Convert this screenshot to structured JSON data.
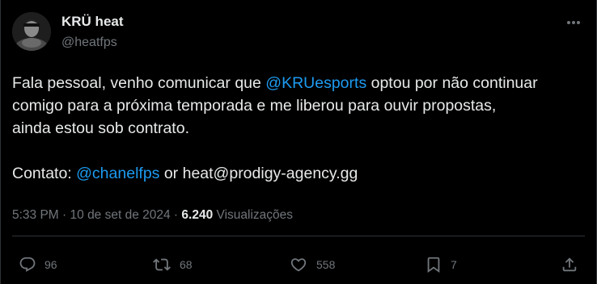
{
  "author": {
    "name": "KRÜ heat",
    "handle": "@heatfps"
  },
  "tweet": {
    "line1_pre": "Fala pessoal, venho comunicar que ",
    "line1_mention": "@KRUesports",
    "line1_post": " optou por não continuar",
    "line2": "comigo para a próxima temporada e me liberou para ouvir propostas,",
    "line3": "ainda estou sob contrato.",
    "contact_pre": "Contato: ",
    "contact_mention": "@chanelfps",
    "contact_post": " or heat@prodigy-agency.gg"
  },
  "meta": {
    "time": "5:33 PM",
    "separator1": " · ",
    "date": "10 de set de 2024",
    "separator2": " · ",
    "views_count": "6.240",
    "views_label": " Visualizações"
  },
  "actions": {
    "replies": "96",
    "reposts": "68",
    "likes": "558",
    "bookmarks": "7"
  },
  "colors": {
    "background": "#000000",
    "text": "#e7e9ea",
    "secondary": "#71767b",
    "link": "#1d9bf0",
    "border": "#2f3336"
  },
  "icons": {
    "more": "more-icon",
    "reply": "reply-icon",
    "repost": "repost-icon",
    "like": "heart-icon",
    "bookmark": "bookmark-icon",
    "share": "share-icon"
  }
}
